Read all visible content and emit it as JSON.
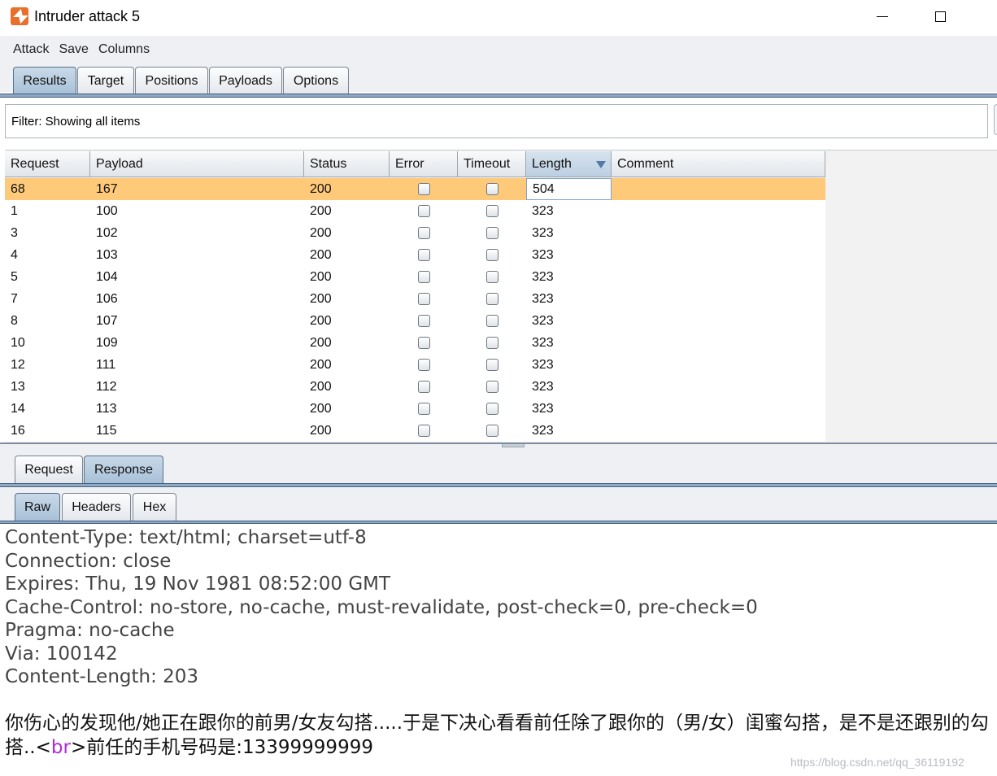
{
  "window": {
    "title": "Intruder attack 5"
  },
  "menu": [
    "Attack",
    "Save",
    "Columns"
  ],
  "main_tabs": [
    {
      "label": "Results",
      "active": true
    },
    {
      "label": "Target",
      "active": false
    },
    {
      "label": "Positions",
      "active": false
    },
    {
      "label": "Payloads",
      "active": false
    },
    {
      "label": "Options",
      "active": false
    }
  ],
  "filter": {
    "text": "Filter:  Showing all items"
  },
  "table": {
    "columns": [
      "Request",
      "Payload",
      "Status",
      "Error",
      "Timeout",
      "Length",
      "Comment"
    ],
    "sorted_column": "Length",
    "rows": [
      {
        "request": "68",
        "payload": "167",
        "status": "200",
        "error": false,
        "timeout": false,
        "length": "504",
        "comment": "",
        "selected": true
      },
      {
        "request": "1",
        "payload": "100",
        "status": "200",
        "error": false,
        "timeout": false,
        "length": "323",
        "comment": ""
      },
      {
        "request": "3",
        "payload": "102",
        "status": "200",
        "error": false,
        "timeout": false,
        "length": "323",
        "comment": ""
      },
      {
        "request": "4",
        "payload": "103",
        "status": "200",
        "error": false,
        "timeout": false,
        "length": "323",
        "comment": ""
      },
      {
        "request": "5",
        "payload": "104",
        "status": "200",
        "error": false,
        "timeout": false,
        "length": "323",
        "comment": ""
      },
      {
        "request": "7",
        "payload": "106",
        "status": "200",
        "error": false,
        "timeout": false,
        "length": "323",
        "comment": ""
      },
      {
        "request": "8",
        "payload": "107",
        "status": "200",
        "error": false,
        "timeout": false,
        "length": "323",
        "comment": ""
      },
      {
        "request": "10",
        "payload": "109",
        "status": "200",
        "error": false,
        "timeout": false,
        "length": "323",
        "comment": ""
      },
      {
        "request": "12",
        "payload": "111",
        "status": "200",
        "error": false,
        "timeout": false,
        "length": "323",
        "comment": ""
      },
      {
        "request": "13",
        "payload": "112",
        "status": "200",
        "error": false,
        "timeout": false,
        "length": "323",
        "comment": ""
      },
      {
        "request": "14",
        "payload": "113",
        "status": "200",
        "error": false,
        "timeout": false,
        "length": "323",
        "comment": ""
      },
      {
        "request": "16",
        "payload": "115",
        "status": "200",
        "error": false,
        "timeout": false,
        "length": "323",
        "comment": ""
      }
    ]
  },
  "detail_tabs": [
    {
      "label": "Request",
      "active": false
    },
    {
      "label": "Response",
      "active": true
    }
  ],
  "view_tabs": [
    {
      "label": "Raw",
      "active": true
    },
    {
      "label": "Headers",
      "active": false
    },
    {
      "label": "Hex",
      "active": false
    }
  ],
  "response": {
    "headers": [
      "Content-Type: text/html; charset=utf-8",
      "Connection: close",
      "Expires: Thu, 19 Nov 1981 08:52:00 GMT",
      "Cache-Control: no-store, no-cache, must-revalidate, post-check=0, pre-check=0",
      "Pragma: no-cache",
      "Via: 100142",
      "Content-Length: 203"
    ],
    "body_before_tag": "你伤心的发现他/她正在跟你的前男/女友勾搭.....于是下决心看看前任除了跟你的（男/女）闺蜜勾搭，是不是还跟别的勾搭..",
    "body_tag_open": "<",
    "body_tag_name": "br",
    "body_tag_close": ">",
    "body_after_tag": "前任的手机号码是:13399999999"
  },
  "watermark": "https://blog.csdn.net/qq_36119192",
  "colors": {
    "selected_row": "#ffc97a",
    "active_tab": "#a8c1d8",
    "tag_highlight": "#b12bd6"
  }
}
